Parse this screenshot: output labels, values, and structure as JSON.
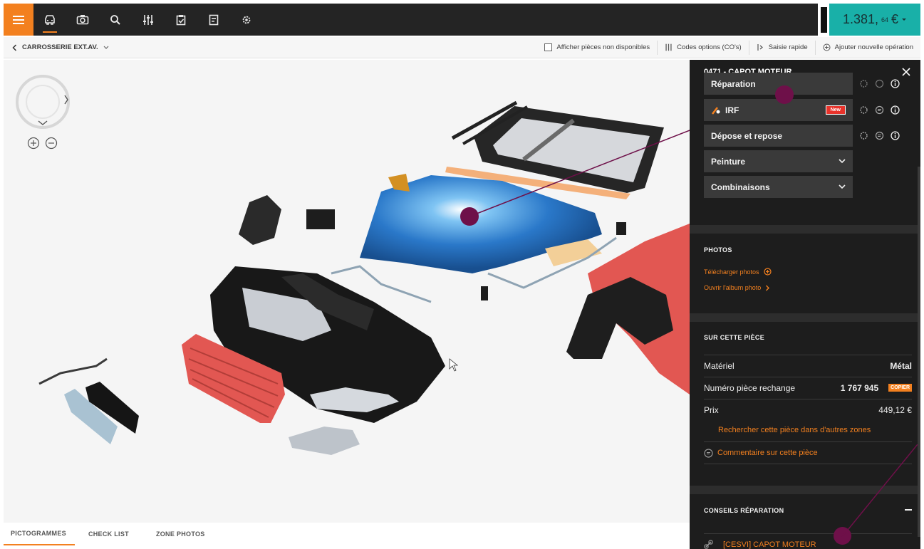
{
  "topbar": {
    "icons": [
      "hamburger-menu-icon",
      "car-icon",
      "camera-icon",
      "search-icon",
      "sliders-icon",
      "clipboard-check-icon",
      "document-icon",
      "gear-icon"
    ],
    "price": {
      "amount": "1.381,",
      "cents": "64",
      "currency": "€"
    },
    "accent": "#f3801f",
    "price_bg": "#19b0a8"
  },
  "subbar": {
    "breadcrumb": "CARROSSERIE EXT.AV.",
    "show_unavailable": "Afficher pièces non disponibles",
    "option_codes": "Codes options (CO's)",
    "quick_entry": "Saisie rapide",
    "add_operation": "Ajouter nouvelle opération"
  },
  "tabs": [
    "PICTOGRAMMES",
    "CHECK LIST",
    "ZONE PHOTOS"
  ],
  "panel": {
    "title": "0471 - CAPOT MOTEUR",
    "operations": {
      "reparation": "Réparation",
      "irf": "IRF",
      "irf_badge": "New",
      "depose": "Dépose et repose",
      "peinture": "Peinture",
      "combinaisons": "Combinaisons"
    },
    "photos": {
      "title": "PHOTOS",
      "upload": "Télécharger photos",
      "open_album": "Ouvrir l'album photo"
    },
    "part": {
      "title": "SUR CETTE PIÈCE",
      "material_label": "Matériel",
      "material_value": "Métal",
      "number_label": "Numéro pièce rechange",
      "number_value": "1 767 945",
      "copy": "COPIER",
      "price_label": "Prix",
      "price_value": "449,12 €",
      "search_other": "Rechercher cette pièce dans d'autres zones",
      "comment": "Commentaire sur cette pièce"
    },
    "advice": {
      "title": "CONSEILS RÉPARATION",
      "link": "[CESVI] CAPOT MOTEUR"
    }
  }
}
